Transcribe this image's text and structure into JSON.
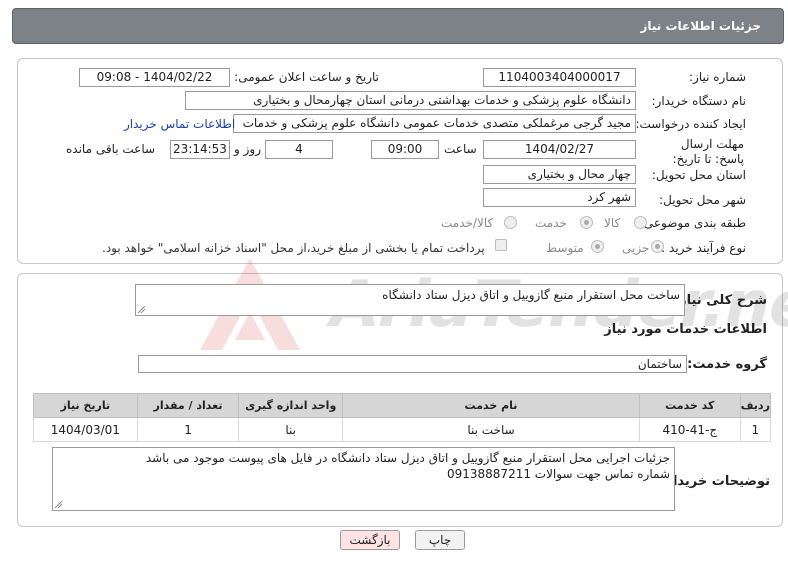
{
  "header": {
    "title": "جزئیات اطلاعات نیاز"
  },
  "form": {
    "need_number": {
      "label": "شماره نیاز:",
      "value": "1104003404000017"
    },
    "announce_datetime": {
      "label": "تاریخ و ساعت اعلان عمومی:",
      "value": "1404/02/22 - 09:08"
    },
    "buyer_org": {
      "label": "نام دستگاه خریدار:",
      "value": "دانشگاه علوم پزشکی و خدمات بهداشتی درمانی استان چهارمحال و بختیاری"
    },
    "requester": {
      "label": "ایجاد کننده درخواست:",
      "value": "مجید گرجی مرغملکی متصدی خدمات عمومی دانشگاه علوم پزشکی و خدمات",
      "contact_link": "اطلاعات تماس خریدار"
    },
    "deadline": {
      "label": "مهلت ارسال پاسخ: تا تاریخ:",
      "date": "1404/02/27",
      "time_label": "ساعت",
      "time": "09:00",
      "days": "4",
      "days_label": "روز و",
      "remaining": "23:14:53",
      "remaining_label": "ساعت باقی مانده"
    },
    "province": {
      "label": "استان محل تحویل:",
      "value": "چهار محال و بختیاری"
    },
    "city": {
      "label": "شهر محل تحویل:",
      "value": "شهر کرد"
    },
    "category": {
      "label": "طبقه بندی موضوعی:",
      "options": [
        "کالا",
        "خدمت",
        "کالا/خدمت"
      ],
      "selected": "خدمت"
    },
    "process": {
      "label": "نوع فرآیند خرید :",
      "options": [
        "جزیی",
        "متوسط"
      ],
      "selected": "جزیی",
      "payment_note": "پرداخت تمام یا بخشی از مبلغ خرید،از محل \"اسناد خزانه اسلامی\" خواهد بود."
    }
  },
  "description": {
    "label": "شرح کلی نیاز:",
    "value": "ساخت محل استقرار منبع گازوییل و اتاق دیزل ستاد دانشگاه"
  },
  "services": {
    "section_title": "اطلاعات خدمات مورد نیاز",
    "group_label": "گروه خدمت:",
    "group_value": "ساختمان",
    "columns": [
      "ردیف",
      "کد خدمت",
      "نام خدمت",
      "واحد اندازه گیری",
      "تعداد / مقدار",
      "تاریخ نیاز"
    ],
    "rows": [
      {
        "row": "1",
        "code": "ج-41-410",
        "name": "ساخت بنا",
        "unit": "بنا",
        "qty": "1",
        "date": "1404/03/01"
      }
    ]
  },
  "buyer_notes": {
    "label": "توضیحات خریدار:",
    "line1": "جزئیات اجرایی محل استقرار منبع گازوییل و اتاق دیزل ستاد دانشگاه در فایل های پیوست موجود می باشد",
    "line2": "شماره تماس جهت سوالات 09138887211"
  },
  "buttons": {
    "print": "چاپ",
    "back": "بازگشت"
  },
  "watermark": {
    "text": "AriaTender.neT"
  },
  "colors": {
    "title_bar": "#7d8188",
    "link": "#1a3fb0",
    "back_button": "#fde3e3",
    "table_header": "#d6d6d6"
  }
}
